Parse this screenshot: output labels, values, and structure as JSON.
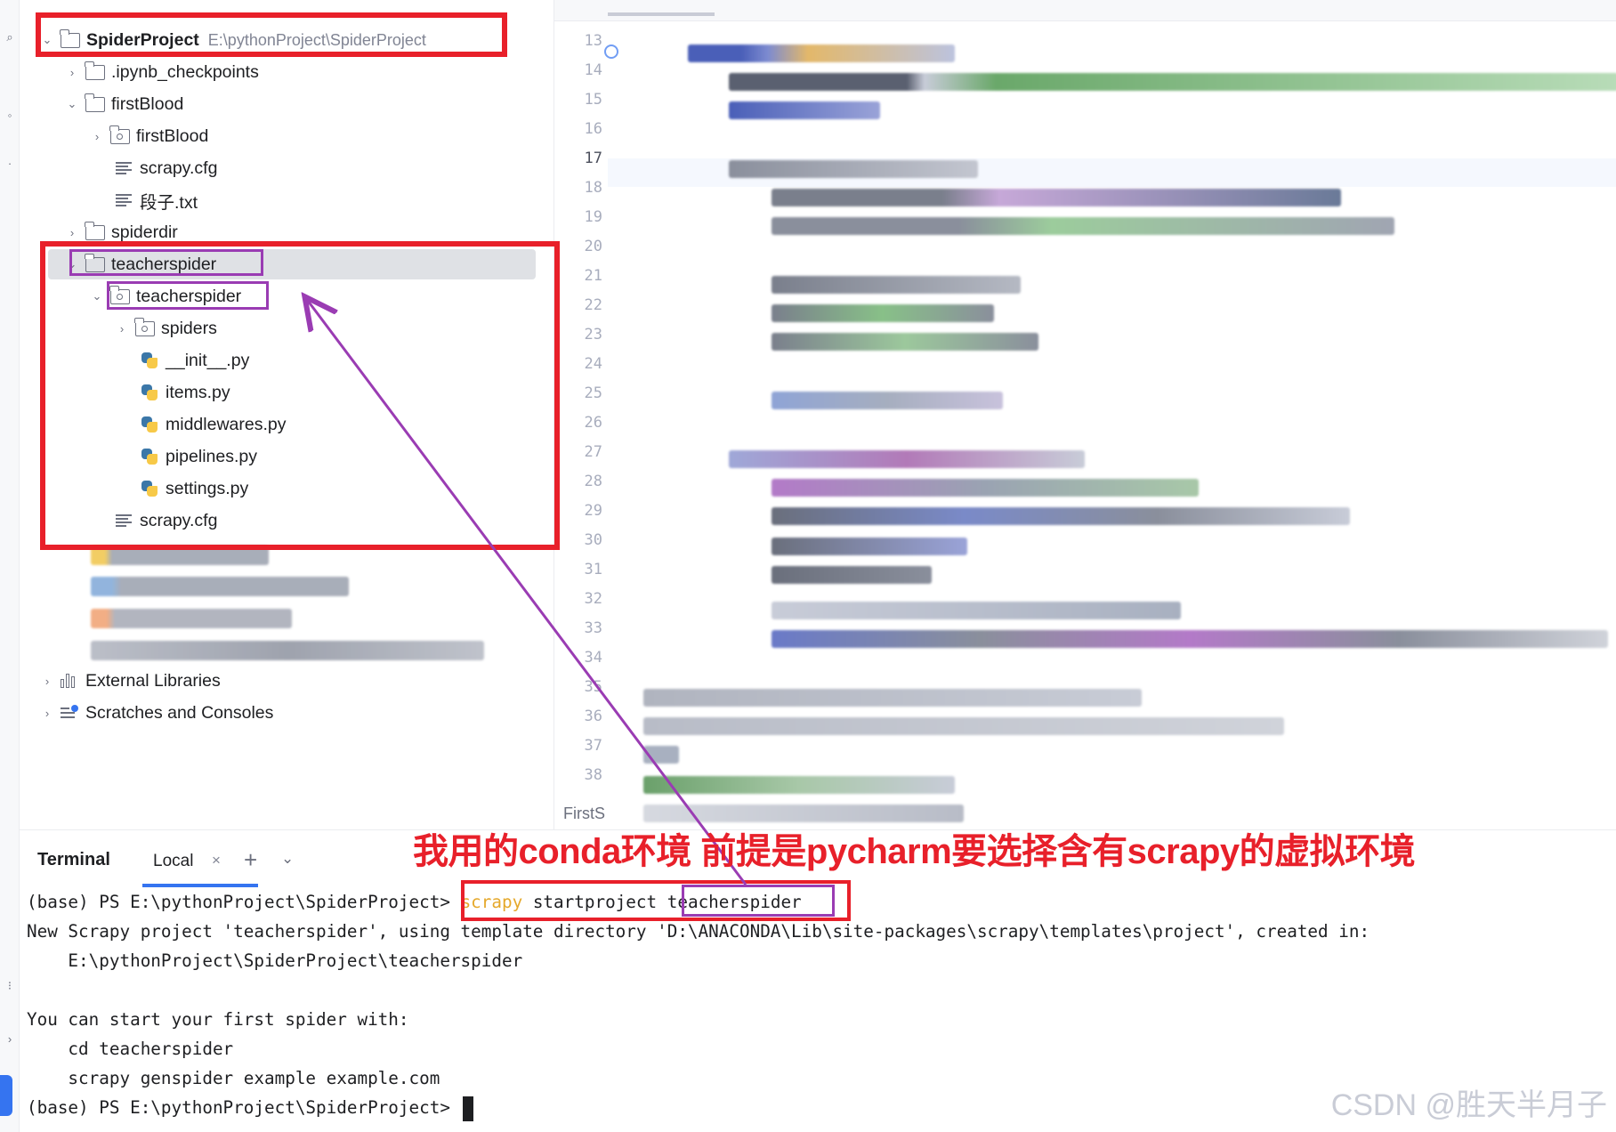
{
  "project_tree": {
    "root": {
      "name": "SpiderProject",
      "path": "E:\\pythonProject\\SpiderProject"
    },
    "items": [
      {
        "label": ".ipynb_checkpoints"
      },
      {
        "label": "firstBlood"
      },
      {
        "label": "firstBlood"
      },
      {
        "label": "scrapy.cfg"
      },
      {
        "label": "段子.txt"
      },
      {
        "label": "spiderdir"
      },
      {
        "label": "teacherspider"
      },
      {
        "label": "teacherspider"
      },
      {
        "label": "spiders"
      },
      {
        "label": "__init__.py"
      },
      {
        "label": "items.py"
      },
      {
        "label": "middlewares.py"
      },
      {
        "label": "pipelines.py"
      },
      {
        "label": "settings.py"
      },
      {
        "label": "scrapy.cfg"
      }
    ],
    "external_libraries": "External Libraries",
    "scratches": "Scratches and Consoles"
  },
  "editor": {
    "line_numbers": [
      "13",
      "14",
      "15",
      "16",
      "17",
      "18",
      "19",
      "20",
      "21",
      "22",
      "23",
      "24",
      "25",
      "26",
      "27",
      "28",
      "29",
      "30",
      "31",
      "32",
      "33",
      "34",
      "35",
      "36",
      "37",
      "38"
    ],
    "current_line": "17",
    "breadcrumb": "FirstS"
  },
  "terminal": {
    "title": "Terminal",
    "tab_label": "Local",
    "tab_close": "×",
    "add": "+",
    "more": "⌄",
    "prompt": "(base) PS E:\\pythonProject\\SpiderProject>",
    "command_keyword": "scrapy",
    "command_verb": "startproject",
    "command_arg": "teacherspider",
    "output": [
      "New Scrapy project 'teacherspider', using template directory 'D:\\ANACONDA\\Lib\\site-packages\\scrapy\\templates\\project', created in:",
      "    E:\\pythonProject\\SpiderProject\\teacherspider",
      "",
      "You can start your first spider with:",
      "    cd teacherspider",
      "    scrapy genspider example example.com"
    ],
    "final_prompt": "(base) PS E:\\pythonProject\\SpiderProject>"
  },
  "annotation": {
    "text": "我用的conda环境 前提是pycharm要选择含有scrapy的虚拟环境",
    "red": "#e8202a",
    "purple": "#9a3cb3"
  },
  "watermark": "CSDN @胜天半月子"
}
